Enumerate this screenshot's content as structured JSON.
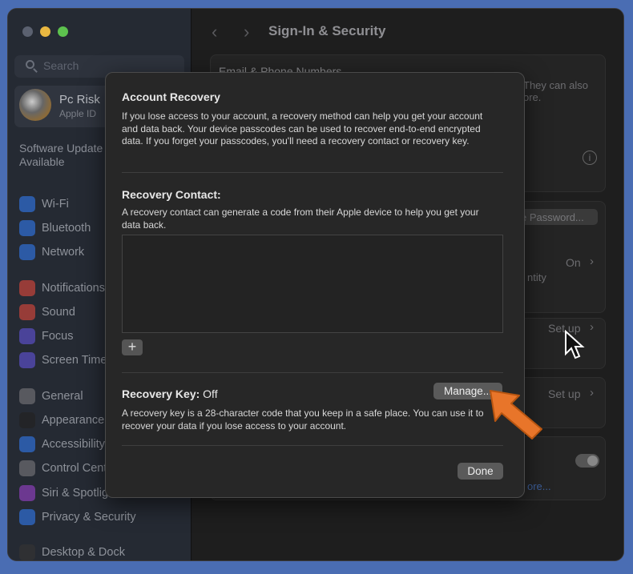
{
  "sidebar": {
    "search_placeholder": "Search",
    "profile": {
      "name": "Pc Risk",
      "subtitle": "Apple ID"
    },
    "update_notice": "Software Update Available",
    "items": [
      {
        "label": "Wi-Fi",
        "icon": "wifi-icon",
        "color": "#2f6fd6"
      },
      {
        "label": "Bluetooth",
        "icon": "bluetooth-icon",
        "color": "#2f6fd6"
      },
      {
        "label": "Network",
        "icon": "globe-icon",
        "color": "#2f6fd6"
      },
      {
        "label": "Notifications",
        "icon": "bell-icon",
        "color": "#c8453a"
      },
      {
        "label": "Sound",
        "icon": "speaker-icon",
        "color": "#c8453a"
      },
      {
        "label": "Focus",
        "icon": "moon-icon",
        "color": "#5a4fc4"
      },
      {
        "label": "Screen Time",
        "icon": "hourglass-icon",
        "color": "#5a4fc4"
      },
      {
        "label": "General",
        "icon": "gear-icon",
        "color": "#6d6d72"
      },
      {
        "label": "Appearance",
        "icon": "appearance-icon",
        "color": "#222222"
      },
      {
        "label": "Accessibility",
        "icon": "accessibility-icon",
        "color": "#2f6fd6"
      },
      {
        "label": "Control Centre",
        "icon": "switches-icon",
        "color": "#6d6d72"
      },
      {
        "label": "Siri & Spotlight",
        "icon": "siri-icon",
        "color": "#8a3fb8"
      },
      {
        "label": "Privacy & Security",
        "icon": "hand-icon",
        "color": "#2f6fd6"
      },
      {
        "label": "Desktop & Dock",
        "icon": "dock-icon",
        "color": "#333333"
      }
    ]
  },
  "main": {
    "title": "Sign-In & Security",
    "email_heading": "Email & Phone Numbers",
    "email_desc_fragment_1": "They can also",
    "email_desc_fragment_2": "ore.",
    "change_password_fragment": "e Password...",
    "two_factor_value": "On",
    "two_factor_fragment": "ntity",
    "row3_value": "Set up",
    "row4_value": "Set up",
    "learn_more_fragment": "ore..."
  },
  "dialog": {
    "title": "Account Recovery",
    "intro": "If you lose access to your account, a recovery method can help you get your account and data back. Your device passcodes can be used to recover end-to-end encrypted data. If you forget your passcodes, you'll need a recovery contact or recovery key.",
    "contact_title": "Recovery Contact:",
    "contact_desc": "A recovery contact can generate a code from their Apple device to help you get your data back.",
    "add_label": "+",
    "key_title": "Recovery Key:",
    "key_status": "Off",
    "manage_label": "Manage...",
    "key_desc": "A recovery key is a 28-character code that you keep in a safe place. You can use it to recover your data if you lose access to your account.",
    "done_label": "Done"
  },
  "colors": {
    "annotation_arrow": "#e8752a",
    "traffic_close": "#5b6170",
    "traffic_min": "#e9b741",
    "traffic_max": "#5dc24e"
  }
}
